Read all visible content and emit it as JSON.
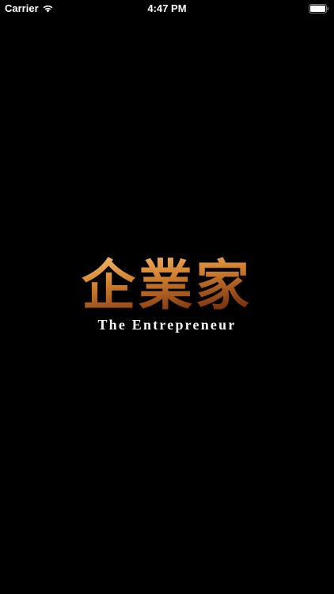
{
  "status_bar": {
    "carrier": "Carrier",
    "time": "4:47 PM",
    "icons": [
      "wifi-icon",
      "battery-icon"
    ]
  },
  "splash": {
    "logo_title": "企業家",
    "logo_subtitle": "The Entrepreneur",
    "colors": {
      "background": "#000000",
      "gold_light": "#f2b05a",
      "gold_dark": "#8a3d12",
      "subtitle": "#f4f4f4"
    }
  }
}
